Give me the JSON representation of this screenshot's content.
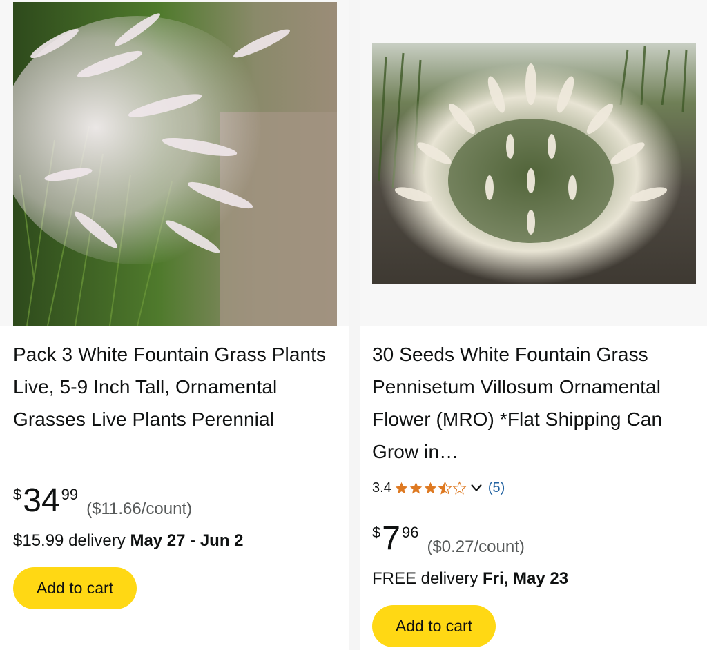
{
  "products": [
    {
      "title": "Pack 3 White Fountain Grass Plants Live, 5-9 Inch Tall, Ornamental Grasses Live Plants Perennial",
      "image_alt": "White fountain grass plants",
      "price": {
        "currency": "$",
        "whole": "34",
        "fraction": "99",
        "unit_price": "($11.66/count)"
      },
      "delivery": {
        "prefix": "$15.99 delivery",
        "dates": "May 27 - Jun 2"
      },
      "cart_label": "Add to cart"
    },
    {
      "title": "30 Seeds White Fountain Grass Pennisetum Villosum Ornamental Flower (MRO) *Flat Shipping Can Grow in…",
      "image_alt": "White fountain grass clump",
      "rating": {
        "value": "3.4",
        "stars": 3.4,
        "count": "(5)"
      },
      "price": {
        "currency": "$",
        "whole": "7",
        "fraction": "96",
        "unit_price": "($0.27/count)"
      },
      "delivery": {
        "prefix": "FREE delivery",
        "dates": "Fri, May 23"
      },
      "cart_label": "Add to cart"
    }
  ],
  "colors": {
    "cart_button": "#ffd814",
    "star": "#de7921",
    "link": "#2162a1",
    "muted": "#565959"
  },
  "icons": {
    "star": "star-icon",
    "chevron": "chevron-down-icon"
  }
}
